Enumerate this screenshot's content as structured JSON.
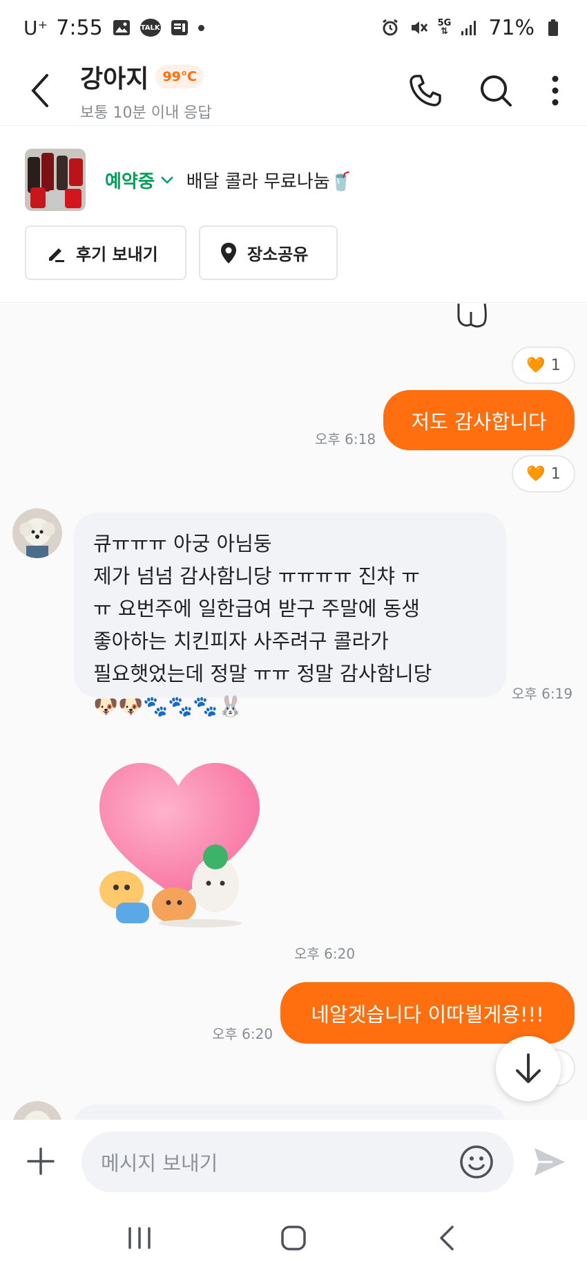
{
  "status_bar": {
    "carrier": "U⁺",
    "time": "7:55",
    "talk_label": "TALK",
    "network": "5G",
    "battery": "71%"
  },
  "header": {
    "name": "강아지",
    "temperature": "99℃",
    "subtitle": "보통 10분 이내 응답"
  },
  "product": {
    "status": "예약중",
    "title": "배달 콜라 무료나눔🥤"
  },
  "actions": {
    "review_label": "후기 보내기",
    "place_label": "장소공유"
  },
  "messages": [
    {
      "direction": "out",
      "text": "저도 감사합니다",
      "time": "오후 6:18",
      "reaction_count": "1"
    },
    {
      "direction": "in",
      "lines": [
        "큐ㅠㅠㅠ 아궁 아님둥",
        "제가 넘넘 감사함니당 ㅠㅠㅠㅠ 진챠 ㅠ",
        "ㅠ 요번주에 일한급여 받구 주말에 동생",
        "좋아하는 치킨피자 사주려구 콜라가",
        "필요햇었는데 정말 ㅠㅠ 정말 감사함니당",
        "🐶🐶🐾🐾🐾🐰"
      ],
      "time": "오후 6:19"
    },
    {
      "direction": "in",
      "type": "sticker",
      "time": "오후 6:20"
    },
    {
      "direction": "out",
      "text": "네알겟습니다 이따뵐게용!!!",
      "time": "오후 6:20",
      "reaction_count": "1"
    }
  ],
  "earlier_reaction_count": "1",
  "input": {
    "placeholder": "메시지 보내기"
  },
  "colors": {
    "accent": "#ff6f0f",
    "reserved_green": "#00a05b"
  }
}
